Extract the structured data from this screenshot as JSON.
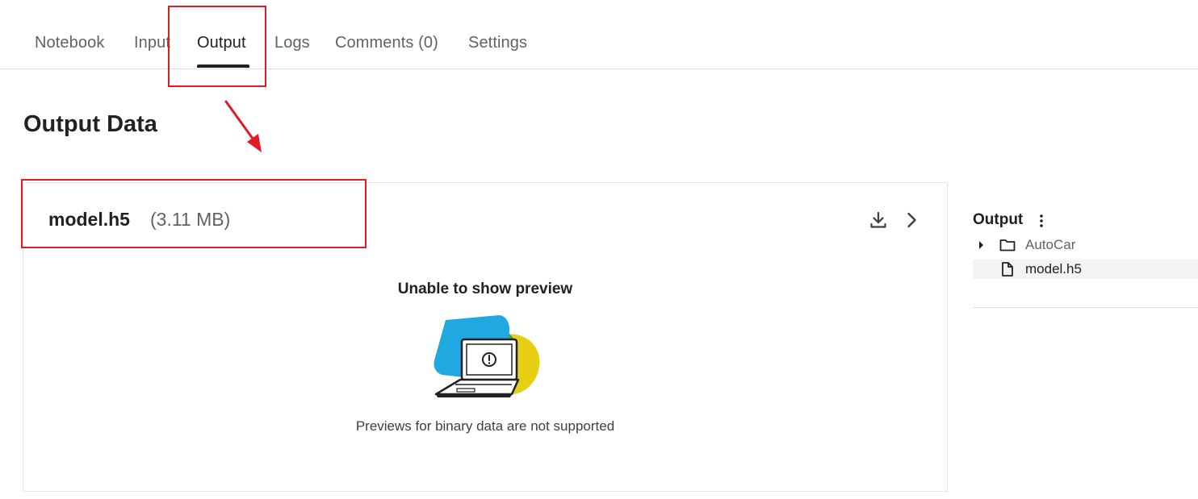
{
  "tabs": [
    {
      "label": "Notebook"
    },
    {
      "label": "Input"
    },
    {
      "label": "Output",
      "active": true
    },
    {
      "label": "Logs"
    },
    {
      "label": "Comments (0)"
    },
    {
      "label": "Settings"
    }
  ],
  "page": {
    "title": "Output Data"
  },
  "file_card": {
    "name": "model.h5",
    "size": "(3.11 MB)",
    "actions": [
      "download-icon",
      "chevron-right-icon"
    ],
    "preview_title": "Unable to show preview",
    "preview_note": "Previews for binary data are not supported"
  },
  "file_tree": {
    "header": "Output",
    "menu_icon": "kebab-menu-icon",
    "items": [
      {
        "label": "AutoCar",
        "type": "folder",
        "expandable": true
      },
      {
        "label": "model.h5",
        "type": "file",
        "selected": true
      }
    ]
  },
  "colors": {
    "annotation": "#e01b24",
    "illustration_blue": "#20a8e0",
    "illustration_yellow": "#e7cf14",
    "illustration_green": "#3ea84a"
  }
}
